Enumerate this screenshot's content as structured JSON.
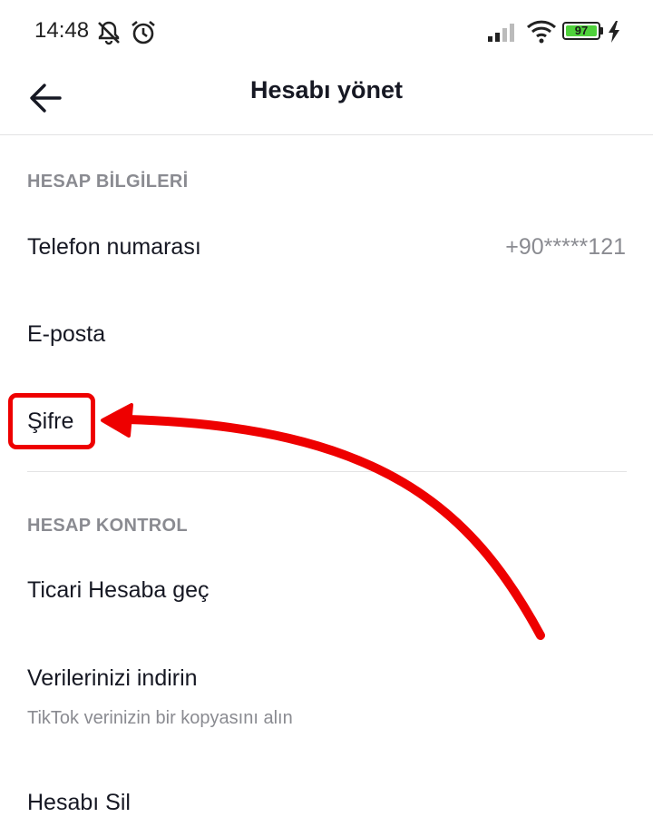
{
  "status_bar": {
    "time": "14:48",
    "battery_level": "97",
    "icons": [
      "muted-notification-icon",
      "alarm-icon",
      "signal-icon",
      "wifi-icon",
      "battery-icon",
      "charging-icon"
    ]
  },
  "header": {
    "title": "Hesabı yönet",
    "back_icon": "back-arrow-icon"
  },
  "sections": {
    "account_info": {
      "header": "HESAP BİLGİLERİ",
      "phone_label": "Telefon numarası",
      "phone_value": "+90*****121",
      "email_label": "E-posta",
      "password_label": "Şifre"
    },
    "account_control": {
      "header": "HESAP KONTROL",
      "business_label": "Ticari Hesaba geç",
      "download_label": "Verilerinizi indirin",
      "download_sub": "TikTok verinizin bir kopyasını alın",
      "delete_label": "Hesabı Sil"
    }
  },
  "colors": {
    "annotation": "#ee0000",
    "muted_text": "#8a8b91",
    "primary_text": "#161823",
    "battery_fill": "#4fd13b"
  }
}
